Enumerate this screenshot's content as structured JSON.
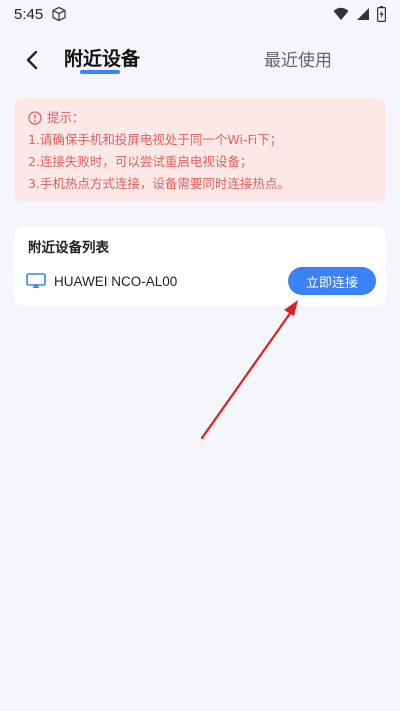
{
  "status_bar": {
    "time": "5:45"
  },
  "header": {
    "tab_nearby": "附近设备",
    "tab_recent": "最近使用"
  },
  "tips": {
    "title": "提示：",
    "lines": [
      "1.请确保手机和投屏电视处于同一个Wi-Fi下；",
      "2.连接失败时，可以尝试重启电视设备；",
      "3.手机热点方式连接，设备需要同时连接热点。"
    ]
  },
  "device_list": {
    "title": "附近设备列表",
    "devices": [
      {
        "name": "HUAWEI NCO-AL00",
        "action": "立即连接"
      }
    ]
  },
  "colors": {
    "accent": "#3b82f6",
    "tip_text": "#e0625f",
    "tip_bg": "#fde8e8",
    "arrow": "#e02020"
  }
}
